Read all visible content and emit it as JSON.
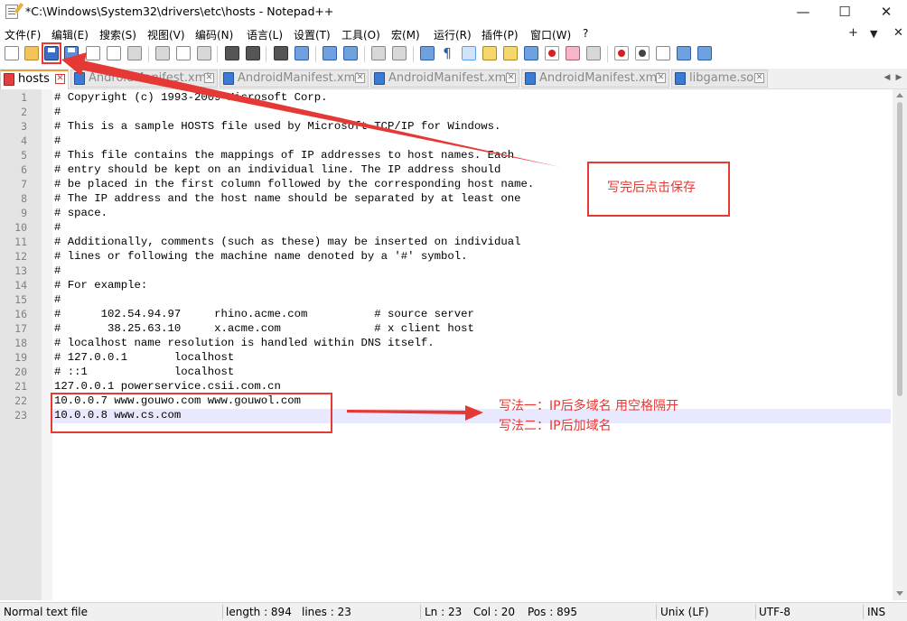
{
  "window": {
    "title": "*C:\\Windows\\System32\\drivers\\etc\\hosts - Notepad++",
    "minimize_glyph": "—",
    "maximize_glyph": "☐",
    "close_glyph": "✕"
  },
  "menu": {
    "items": [
      "文件(F)",
      "编辑(E)",
      "搜索(S)",
      "视图(V)",
      "编码(N)",
      "语言(L)",
      "设置(T)",
      "工具(O)",
      "宏(M)",
      "运行(R)",
      "插件(P)",
      "窗口(W)",
      "?"
    ],
    "right_plus": "+",
    "right_down": "▼",
    "right_close": "✕"
  },
  "toolbar": {
    "icons": [
      "new-file-icon",
      "open-file-icon",
      "save-icon",
      "save-all-icon",
      "close-icon",
      "close-all-icon",
      "print-icon",
      "cut-icon",
      "copy-icon",
      "paste-icon",
      "undo-icon",
      "redo-icon",
      "find-icon",
      "replace-icon",
      "zoom-in-icon",
      "zoom-out-icon",
      "sync-vertical-icon",
      "sync-horizontal-icon",
      "word-wrap-icon",
      "show-all-chars-icon",
      "indent-guide-icon",
      "user-language-icon",
      "doc-map-icon",
      "function-list-icon",
      "folder-workspace-icon",
      "doc-switcher-icon",
      "monitoring-icon",
      "record-macro-icon",
      "stop-record-icon",
      "play-macro-icon",
      "run-macro-multiple-icon",
      "save-macro-icon"
    ],
    "pilcrow": "¶"
  },
  "tabs": [
    {
      "label": "hosts",
      "active": true
    },
    {
      "label": "AndroidManifest.xml",
      "active": false
    },
    {
      "label": "AndroidManifest.xml",
      "active": false
    },
    {
      "label": "AndroidManifest.xml",
      "active": false
    },
    {
      "label": "AndroidManifest.xml",
      "active": false
    },
    {
      "label": "libgame.so",
      "active": false
    }
  ],
  "tab_close_glyph": "✕",
  "tab_scroll": {
    "left": "◀",
    "right": "▶"
  },
  "editor": {
    "lines": [
      "# Copyright (c) 1993-2009 Microsoft Corp.",
      "#",
      "# This is a sample HOSTS file used by Microsoft TCP/IP for Windows.",
      "#",
      "# This file contains the mappings of IP addresses to host names. Each",
      "# entry should be kept on an individual line. The IP address should",
      "# be placed in the first column followed by the corresponding host name.",
      "# The IP address and the host name should be separated by at least one",
      "# space.",
      "#",
      "# Additionally, comments (such as these) may be inserted on individual",
      "# lines or following the machine name denoted by a '#' symbol.",
      "#",
      "# For example:",
      "#",
      "#      102.54.94.97     rhino.acme.com          # source server",
      "#       38.25.63.10     x.acme.com              # x client host",
      "# localhost name resolution is handled within DNS itself.",
      "# 127.0.0.1       localhost",
      "# ::1             localhost",
      "127.0.0.1 powerservice.csii.com.cn",
      "10.0.0.7 www.gouwo.com www.gouwol.com",
      "10.0.0.8 www.cs.com"
    ],
    "current_line": 23
  },
  "annotations": {
    "save_note": "写完后点击保存",
    "method1": "写法一：IP后多域名 用空格隔开",
    "method2": "写法二：IP后加域名",
    "accent_color": "#e53935"
  },
  "status": {
    "file_type": "Normal text file",
    "length": "length : 894",
    "lines": "lines : 23",
    "ln": "Ln : 23",
    "col": "Col : 20",
    "pos": "Pos : 895",
    "eol": "Unix (LF)",
    "encoding": "UTF-8",
    "mode": "INS"
  }
}
